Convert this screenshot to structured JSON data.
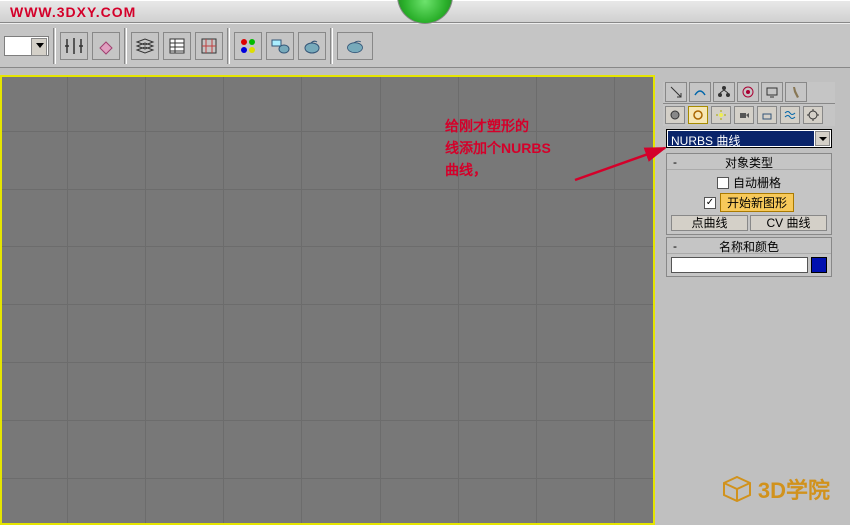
{
  "watermark": "WWW.3DXY.COM",
  "annotation": {
    "line1": "给刚才塑形的",
    "line2": "线添加个NURBS",
    "line3": "曲线，"
  },
  "dropdown": {
    "selected": "NURBS 曲线"
  },
  "rollout_object_type": {
    "title": "对象类型",
    "autogrid": "自动栅格",
    "start_new_shape": "开始新图形",
    "point_curve": "点曲线",
    "cv_curve": "CV 曲线"
  },
  "rollout_name_color": {
    "title": "名称和颜色"
  },
  "logo_text": "3D学院",
  "toolbar": {
    "icons": [
      "mirror",
      "erase",
      "layers",
      "table",
      "snap",
      "colors",
      "small-teapot",
      "mid-teapot",
      "big-teapot"
    ]
  },
  "cmd_tabs": [
    "arrow",
    "curve",
    "hierarchy",
    "wheel",
    "display",
    "hammer"
  ],
  "sub_icons": [
    "sphere",
    "shapes-active",
    "camera",
    "cinema",
    "plane",
    "waves",
    "gear"
  ]
}
